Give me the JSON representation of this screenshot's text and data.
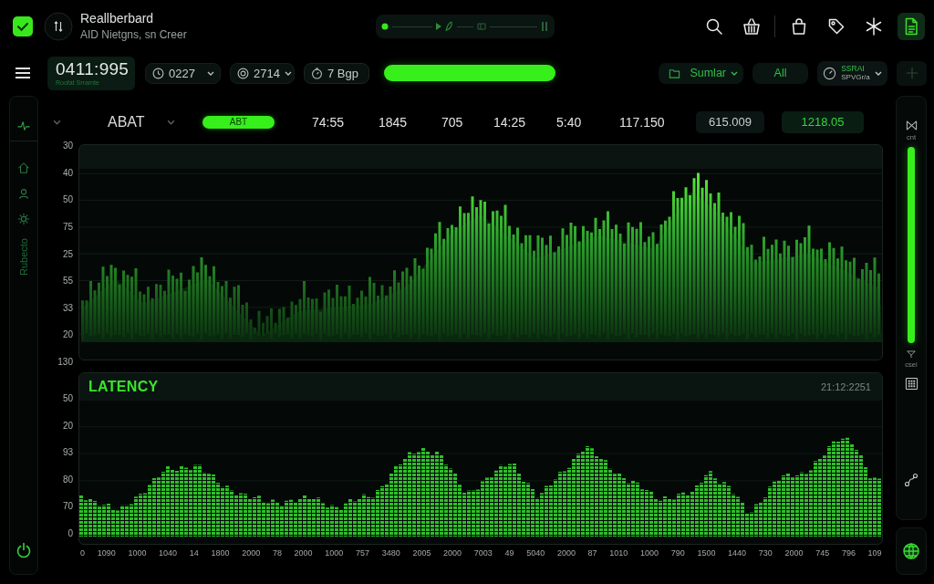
{
  "app": {
    "title": "Reallberbard",
    "subtitle": "AID Nietgns, sn Creer"
  },
  "toolbar_groups": [
    {
      "buttons": [
        {
          "kind": "search",
          "selected": false
        },
        {
          "kind": "basket",
          "selected": false
        }
      ]
    },
    {
      "buttons": [
        {
          "kind": "bag",
          "selected": false
        },
        {
          "kind": "tag",
          "selected": false
        },
        {
          "kind": "asterisk",
          "selected": false
        },
        {
          "kind": "document",
          "selected": true
        }
      ]
    }
  ],
  "readout": {
    "value": "0411:995",
    "caption": "Roofat Srrarnte"
  },
  "filters": [
    {
      "kind": "clock",
      "value": "0227",
      "dropdown": true
    },
    {
      "kind": "target",
      "value": "2714",
      "dropdown": true
    },
    {
      "kind": "timer",
      "value": "7 Bgp",
      "dropdown": false
    }
  ],
  "progress": {
    "level": 1
  },
  "views": [
    {
      "kind": "folder",
      "label": "Sumlar",
      "dropdown": true
    },
    {
      "kind": "plain",
      "label": "All",
      "dropdown": false
    },
    {
      "kind": "dial",
      "label": "SSRAI",
      "sublabel": "SPVGr/a",
      "dropdown": true
    }
  ],
  "sidebar": {
    "label": "Rubecto"
  },
  "summary": {
    "label": "ABAT",
    "badge": "ABT",
    "values": [
      "74:55",
      "1845",
      "705",
      "14:25",
      "5:40",
      "117.150"
    ],
    "chips": [
      {
        "text": "615.009",
        "highlighted": false
      },
      {
        "text": "1218.05",
        "highlighted": true
      }
    ]
  },
  "main_chart": {
    "y_labels": [
      "30",
      "40",
      "50",
      "75",
      "25",
      "55",
      "33",
      "20",
      "130"
    ]
  },
  "latency": {
    "title": "LATENCY",
    "timestamp": "21:12:2251",
    "y_labels": [
      "50",
      "20",
      "93",
      "80",
      "70",
      "0"
    ],
    "x_labels": [
      "0",
      "1090",
      "1000",
      "1040",
      "14",
      "1800",
      "2000",
      "78",
      "2000",
      "1000",
      "757",
      "3480",
      "2005",
      "2000",
      "7003",
      "49",
      "5040",
      "2000",
      "87",
      "1010",
      "1000",
      "790",
      "1500",
      "1440",
      "730",
      "2000",
      "745",
      "796",
      "109"
    ]
  },
  "meter_panel": {
    "top_label": "cnt",
    "level": 1,
    "bottom_label": "csei"
  }
}
